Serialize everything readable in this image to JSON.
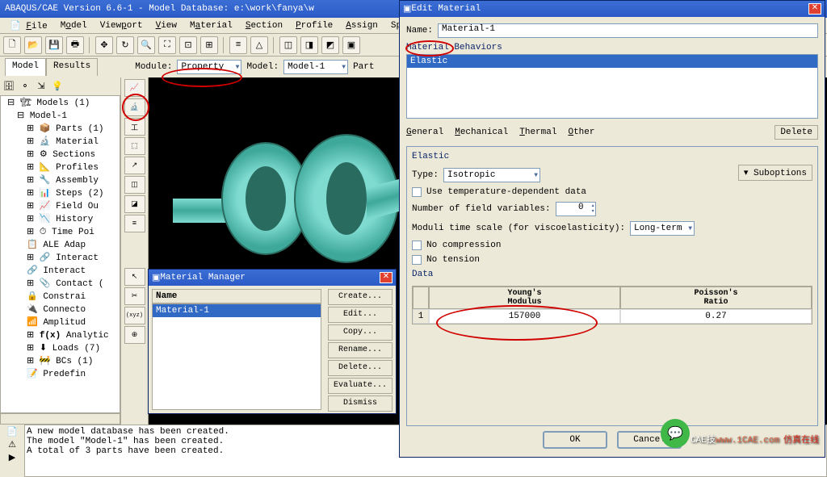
{
  "app": {
    "title": "ABAQUS/CAE Version 6.6-1 - Model Database: e:\\work\\fanya\\w"
  },
  "menus": {
    "file": "File",
    "model": "Model",
    "viewport": "Viewport",
    "view": "View",
    "material": "Material",
    "section": "Section",
    "profile": "Profile",
    "assign": "Assign",
    "special": "Speci"
  },
  "context": {
    "module_lbl": "Module:",
    "module_val": "Property",
    "model_lbl": "Model:",
    "model_val": "Model-1",
    "part_lbl": "Part"
  },
  "tabs": {
    "model": "Model",
    "results": "Results"
  },
  "tree": {
    "root": "Models (1)",
    "m1": "Model-1",
    "items": [
      "Parts (1)",
      "Material",
      "Sections",
      "Profiles",
      "Assembly",
      "Steps (2)",
      "Field Ou",
      "History",
      "Time Poi",
      "ALE Adap",
      "Interact",
      "Interact",
      "Contact (",
      "Constrai",
      "Connecto",
      "Amplitud",
      "Analytic",
      "Loads (7)",
      "BCs (1)",
      "Predefin"
    ]
  },
  "icons": [
    "f(x)"
  ],
  "messages": {
    "l1": "A new model database has been created.",
    "l2": "The model \"Model-1\" has been created.",
    "l3": "A total of 3 parts have been created."
  },
  "matmgr": {
    "title": "Material Manager",
    "hdr": "Name",
    "row": "Material-1",
    "btns": {
      "create": "Create...",
      "edit": "Edit...",
      "copy": "Copy...",
      "rename": "Rename...",
      "delete": "Delete...",
      "evaluate": "Evaluate...",
      "dismiss": "Dismiss"
    }
  },
  "editmat": {
    "title": "Edit Material",
    "name_lbl": "Name:",
    "name_val": "Material-1",
    "beh_lbl": "Material Behaviors",
    "beh_row": "Elastic",
    "tabs": {
      "general": "General",
      "mechanical": "Mechanical",
      "thermal": "Thermal",
      "other": "Other",
      "delete": "Delete"
    },
    "elastic": {
      "grplabel": "Elastic",
      "type_lbl": "Type:",
      "type_val": "Isotropic",
      "sub": "Suboptions",
      "tempdep": "Use temperature-dependent data",
      "nfv_lbl": "Number of field variables:",
      "nfv_val": "0",
      "mts_lbl": "Moduli time scale (for viscoelasticity):",
      "mts_val": "Long-term",
      "nocomp": "No compression",
      "noten": "No tension",
      "data_lbl": "Data",
      "col1": "Young's\nModulus",
      "col2": "Poisson's\nRatio",
      "v1": "157000",
      "v2": "0.27"
    },
    "ok": "OK",
    "cancel": "Cancel"
  },
  "watermark": {
    "site": "www.1CAE.com",
    "txt": "CAE技",
    "brand": "仿真在线"
  }
}
